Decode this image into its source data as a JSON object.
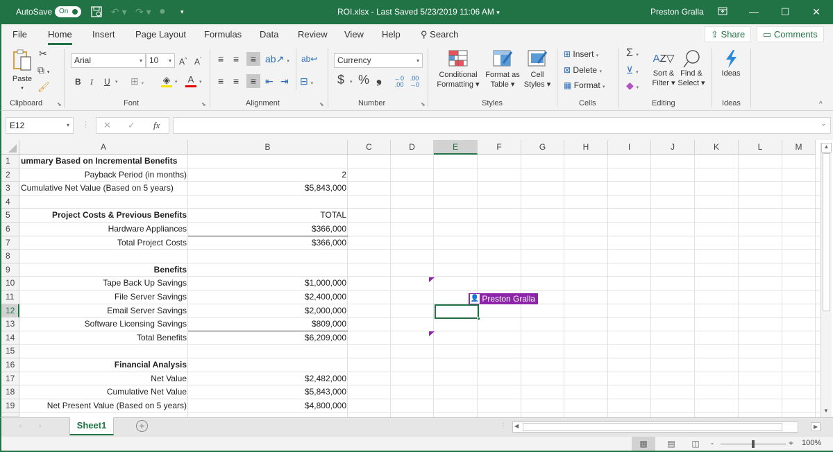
{
  "titlebar": {
    "autosave_label": "AutoSave",
    "autosave_state": "On",
    "document_title": "ROI.xlsx  -  Last Saved 5/23/2019 11:06 AM",
    "title_dropdown": "▾",
    "user_name": "Preston Gralla",
    "icons": {
      "save": "save-icon",
      "undo": "undo-icon",
      "redo": "redo-icon",
      "touch": "touch-mode-icon",
      "customize": "customize-qat-icon",
      "ribbon_display": "ribbon-display-icon"
    },
    "minimize": "—",
    "maximize": "☐",
    "close": "✕"
  },
  "tabs": [
    {
      "label": "File"
    },
    {
      "label": "Home"
    },
    {
      "label": "Insert"
    },
    {
      "label": "Page Layout"
    },
    {
      "label": "Formulas"
    },
    {
      "label": "Data"
    },
    {
      "label": "Review"
    },
    {
      "label": "View"
    },
    {
      "label": "Help"
    }
  ],
  "active_tab": "Home",
  "search_label": "Search",
  "share_label": "Share",
  "comments_label": "Comments",
  "ribbon": {
    "clipboard": {
      "label": "Clipboard",
      "paste": "Paste"
    },
    "font": {
      "label": "Font",
      "font_name": "Arial",
      "font_size": "10",
      "bold": "B",
      "italic": "I",
      "underline": "U",
      "font_color": "A"
    },
    "alignment": {
      "label": "Alignment"
    },
    "number": {
      "label": "Number",
      "format": "Currency",
      "currency_symbol": "$",
      "percent": "%",
      "comma": "❟"
    },
    "styles": {
      "label": "Styles",
      "conditional_1": "Conditional",
      "conditional_2": "Formatting ▾",
      "table_1": "Format as",
      "table_2": "Table ▾",
      "cell_1": "Cell",
      "cell_2": "Styles ▾"
    },
    "cells": {
      "label": "Cells",
      "insert": "Insert",
      "delete": "Delete",
      "format": "Format"
    },
    "editing": {
      "label": "Editing",
      "sort_1": "Sort &",
      "sort_2": "Filter ▾",
      "find_1": "Find &",
      "find_2": "Select ▾"
    },
    "ideas": {
      "label": "Ideas",
      "button": "Ideas"
    }
  },
  "formula_bar": {
    "name_box": "E12",
    "cancel": "✕",
    "enter": "✓",
    "fx": "fx",
    "value": ""
  },
  "columns": [
    "A",
    "B",
    "C",
    "D",
    "E",
    "F",
    "G",
    "H",
    "I",
    "J",
    "K",
    "L",
    "M"
  ],
  "selected_column": "E",
  "selected_row": "12",
  "rows": [
    {
      "n": "1",
      "a": "ummary Based on Incremental Benefits",
      "a_bold": true,
      "b": ""
    },
    {
      "n": "2",
      "a": "Payback Period (in months)",
      "b": "2"
    },
    {
      "n": "3",
      "a": "Cumulative Net Value  (Based on 5 years)",
      "b": "$5,843,000"
    },
    {
      "n": "4",
      "a": "",
      "b": ""
    },
    {
      "n": "5",
      "a": "Project Costs & Previous Benefits",
      "a_bold": true,
      "b": "TOTAL"
    },
    {
      "n": "6",
      "a": "Hardware Appliances",
      "b": "$366,000"
    },
    {
      "n": "7",
      "a": "Total Project Costs",
      "b": "$366,000"
    },
    {
      "n": "8",
      "a": "",
      "b": ""
    },
    {
      "n": "9",
      "a": "Benefits",
      "a_bold": true,
      "b": ""
    },
    {
      "n": "10",
      "a": "Tape Back Up Savings",
      "b": "$1,000,000"
    },
    {
      "n": "11",
      "a": "File Server Savings",
      "b": "$2,400,000"
    },
    {
      "n": "12",
      "a": "Email Server Savings",
      "b": "$2,000,000"
    },
    {
      "n": "13",
      "a": "Software Licensing Savings",
      "b": "$809,000"
    },
    {
      "n": "14",
      "a": "Total Benefits",
      "b": "$6,209,000"
    },
    {
      "n": "15",
      "a": "",
      "b": ""
    },
    {
      "n": "16",
      "a": "Financial Analysis",
      "a_bold": true,
      "b": ""
    },
    {
      "n": "17",
      "a": "Net Value",
      "b": "$2,482,000"
    },
    {
      "n": "18",
      "a": "Cumulative Net Value ",
      "b": "$5,843,000"
    },
    {
      "n": "19",
      "a": "Net Present Value (Based on 5 years)",
      "b": "$4,800,000"
    }
  ],
  "collaborator_flag": {
    "name": "Preston Gralla",
    "color": "#8e24aa"
  },
  "sheets": [
    {
      "label": "Sheet1"
    }
  ],
  "active_sheet": "Sheet1",
  "add_sheet": "+",
  "status": {
    "zoom_level": "100%",
    "zoom_minus": "-",
    "zoom_plus": "+",
    "zoom_fraction": 0.5
  },
  "colors": {
    "accent": "#217346",
    "collab": "#8e24aa"
  }
}
